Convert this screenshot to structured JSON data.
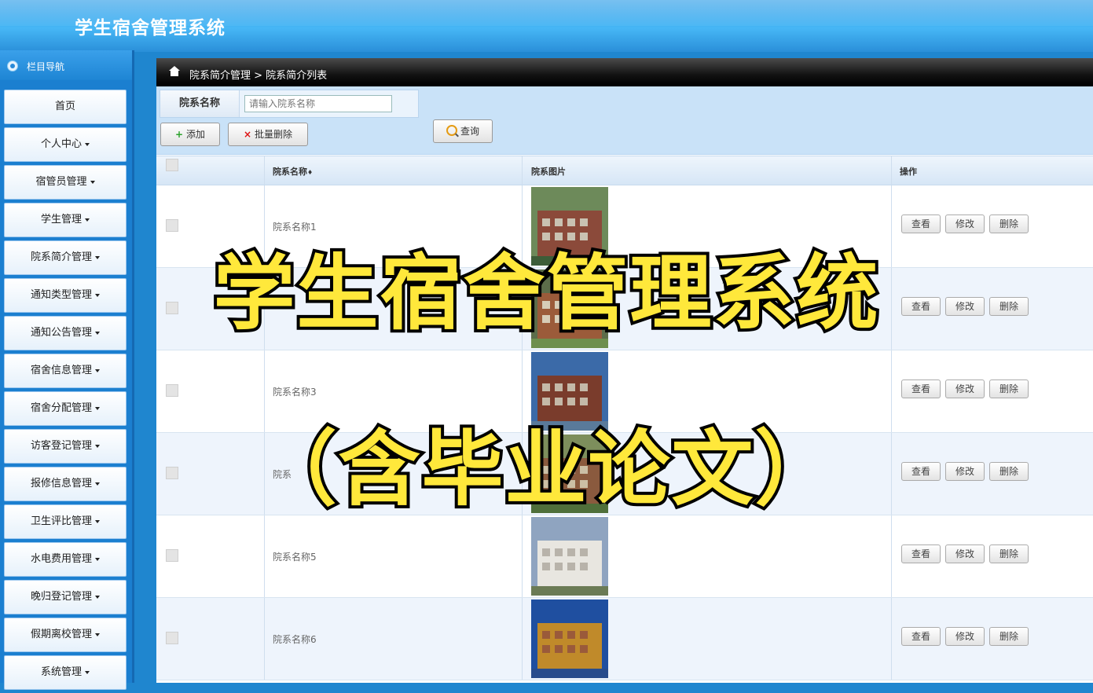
{
  "app": {
    "title": "学生宿舍管理系统"
  },
  "sidebar": {
    "header": "栏目导航",
    "items": [
      {
        "label": "首页",
        "caret": false
      },
      {
        "label": "个人中心",
        "caret": true
      },
      {
        "label": "宿管员管理",
        "caret": true
      },
      {
        "label": "学生管理",
        "caret": true
      },
      {
        "label": "院系简介管理",
        "caret": true
      },
      {
        "label": "通知类型管理",
        "caret": true
      },
      {
        "label": "通知公告管理",
        "caret": true
      },
      {
        "label": "宿舍信息管理",
        "caret": true
      },
      {
        "label": "宿舍分配管理",
        "caret": true
      },
      {
        "label": "访客登记管理",
        "caret": true
      },
      {
        "label": "报修信息管理",
        "caret": true
      },
      {
        "label": "卫生评比管理",
        "caret": true
      },
      {
        "label": "水电费用管理",
        "caret": true
      },
      {
        "label": "晚归登记管理",
        "caret": true
      },
      {
        "label": "假期离校管理",
        "caret": true
      },
      {
        "label": "系统管理",
        "caret": true
      }
    ]
  },
  "breadcrumb": "院系简介管理 > 院系简介列表",
  "search": {
    "label": "院系名称",
    "placeholder": "请输入院系名称",
    "query_label": "查询"
  },
  "actions": {
    "add_label": "添加",
    "batch_delete_label": "批量删除"
  },
  "table": {
    "headers": [
      "院系名称",
      "院系图片",
      "操作"
    ],
    "name_sort_symbol": "♦",
    "rows": [
      {
        "name": "院系名称1"
      },
      {
        "name": ""
      },
      {
        "name": "院系名称3"
      },
      {
        "name": "院系"
      },
      {
        "name": "院系名称5"
      },
      {
        "name": "院系名称6"
      }
    ],
    "op_labels": [
      "查看",
      "修改",
      "删除"
    ]
  },
  "overlay": {
    "line1": "学生宿舍管理系统",
    "line2": "（含毕业论文）"
  },
  "colors": {
    "accent": "#1f86cf",
    "overlay_text": "#ffe83b"
  }
}
